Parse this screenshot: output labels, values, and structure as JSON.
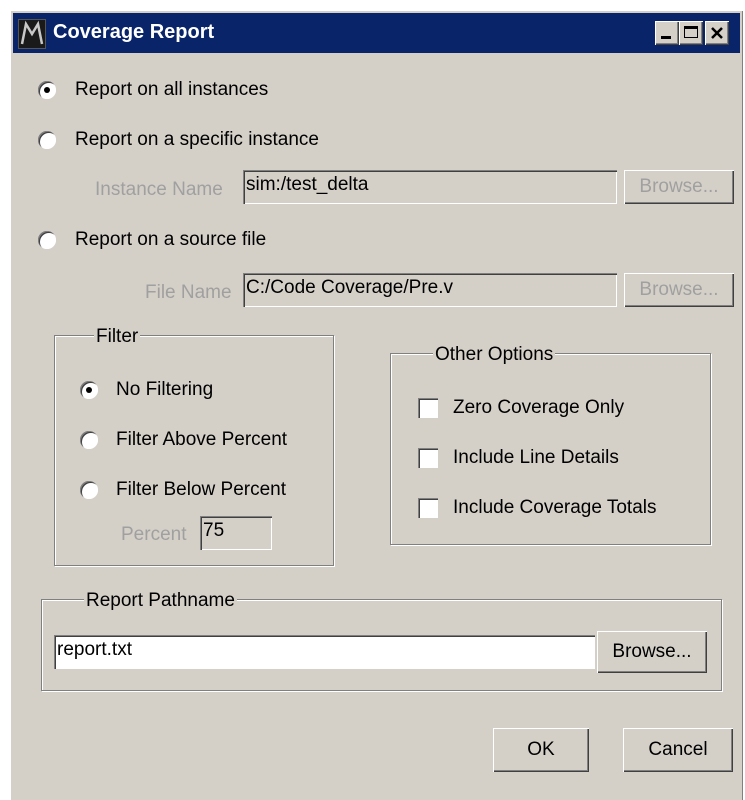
{
  "window": {
    "title": "Coverage Report"
  },
  "scope": {
    "all_instances": {
      "label": "Report on all instances",
      "selected": true
    },
    "specific_instance": {
      "label": "Report on a specific instance",
      "selected": false
    },
    "instance_name": {
      "label": "Instance Name",
      "value": "sim:/test_delta",
      "browse": "Browse..."
    },
    "source_file": {
      "label": "Report on a source file",
      "selected": false
    },
    "file_name": {
      "label": "File Name",
      "value": "C:/Code Coverage/Pre.v",
      "browse": "Browse..."
    }
  },
  "filter": {
    "title": "Filter",
    "no_filtering": {
      "label": "No Filtering",
      "selected": true
    },
    "above": {
      "label": "Filter Above Percent",
      "selected": false
    },
    "below": {
      "label": "Filter Below Percent",
      "selected": false
    },
    "percent": {
      "label": "Percent",
      "value": "75"
    }
  },
  "other_options": {
    "title": "Other Options",
    "zero_coverage": {
      "label": "Zero Coverage Only",
      "checked": false
    },
    "line_details": {
      "label": "Include Line Details",
      "checked": false
    },
    "coverage_totals": {
      "label": "Include Coverage Totals",
      "checked": false
    }
  },
  "pathname": {
    "title": "Report Pathname",
    "value": "report.txt",
    "browse": "Browse..."
  },
  "buttons": {
    "ok": "OK",
    "cancel": "Cancel"
  },
  "colors": {
    "title_bar": "#0a246a",
    "face": "#d4d0c8",
    "disabled_text": "#a0a0a0"
  }
}
